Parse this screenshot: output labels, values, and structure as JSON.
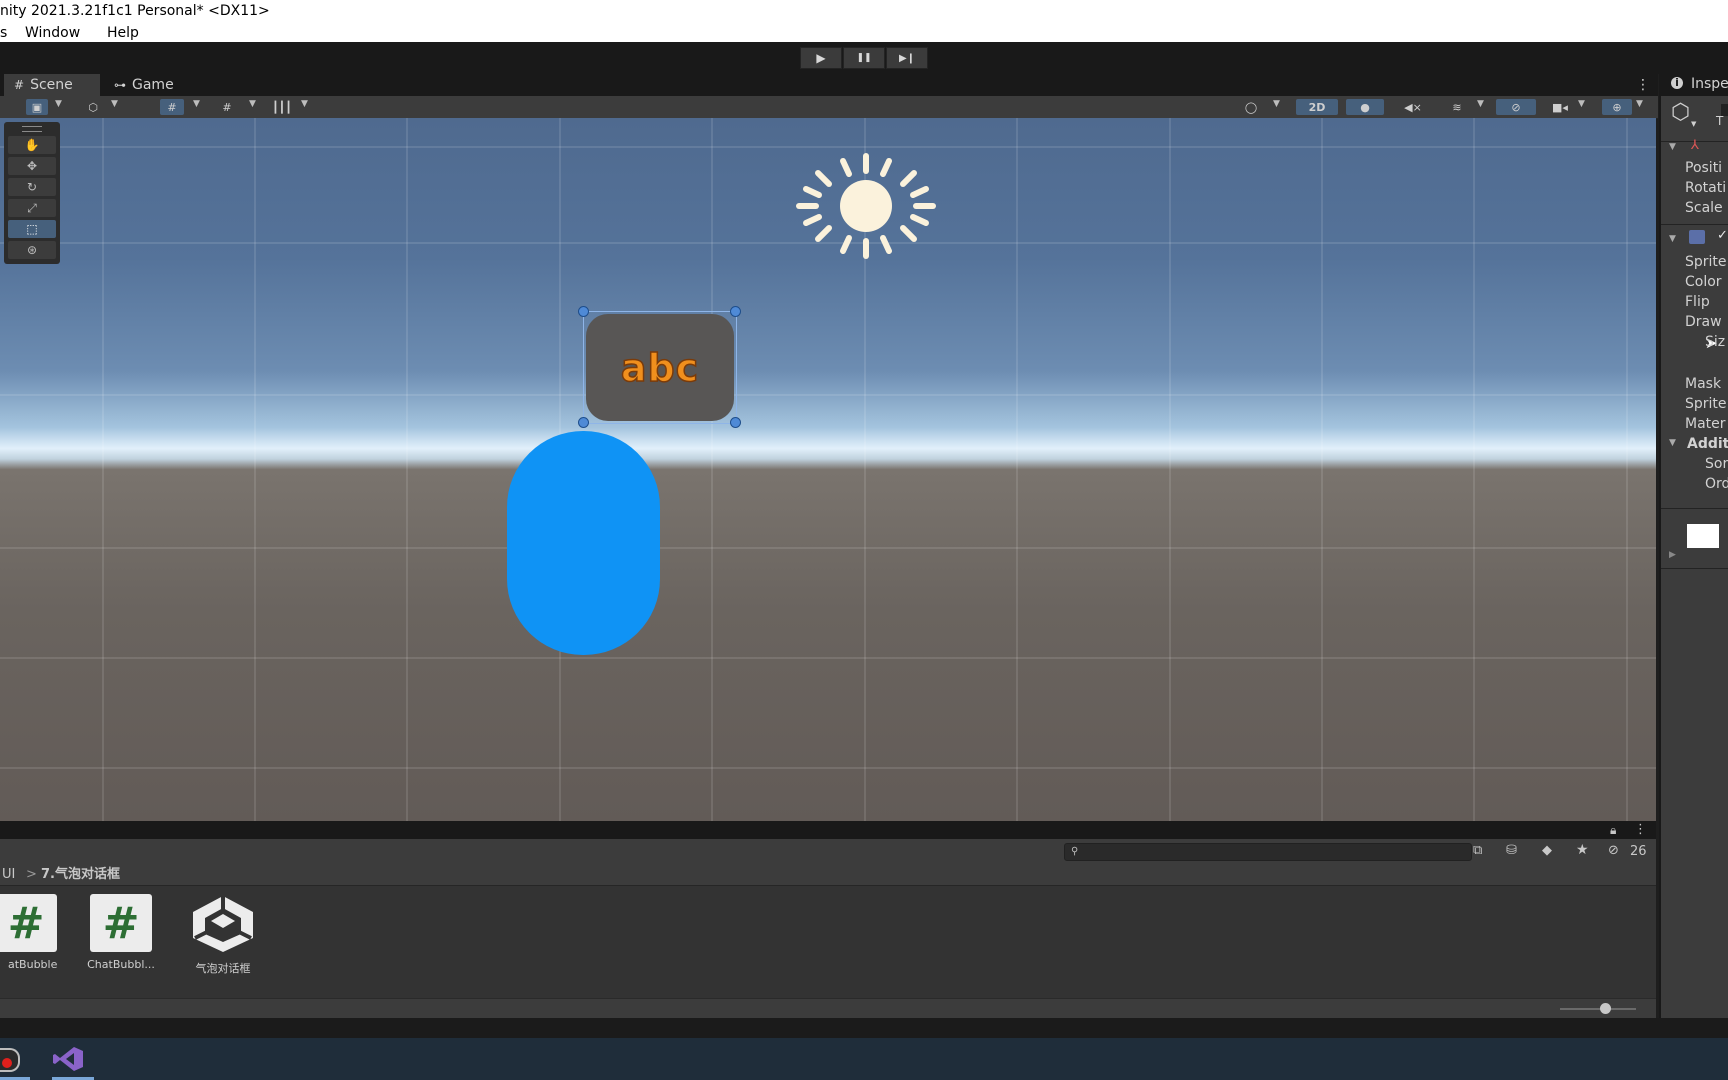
{
  "window": {
    "title": "nity 2021.3.21f1c1 Personal* <DX11>"
  },
  "menu": {
    "items": [
      "s",
      "Window",
      "Help"
    ]
  },
  "play_controls": {
    "play": "▶",
    "pause": "❚❚",
    "step": "▶❙"
  },
  "scene_view": {
    "tabs": [
      {
        "label": "Scene",
        "icon": "grid-hash-icon"
      },
      {
        "label": "Game",
        "icon": "gamepad-icon"
      }
    ],
    "toggle_2d": "2D",
    "tools": [
      "hand-tool",
      "move-tool",
      "rotate-tool",
      "scale-tool",
      "rect-tool",
      "transform-tool"
    ],
    "selected_object_text": "abc",
    "colors": {
      "capsule": "#0f93f5",
      "sun": "#fbf2dc",
      "text_fill": "#f08f1d",
      "sprite_bg": "#585655"
    }
  },
  "inspector": {
    "tab": "Inspe",
    "header_sub": "T",
    "transform_rows": [
      "Positi",
      "Rotati",
      "Scale"
    ],
    "renderer_rows": [
      "Sprite",
      "Color",
      "Flip",
      "Draw",
      "Siz",
      "Mask",
      "Sprite",
      "Mater"
    ],
    "additional": {
      "heading": "Additi",
      "rows": [
        "Sor",
        "Ord"
      ]
    }
  },
  "project": {
    "breadcrumb": {
      "root": "UI",
      "separator": ">",
      "folder": "7.气泡对话框"
    },
    "search": {
      "placeholder": ""
    },
    "hidden_count": "26",
    "assets": [
      {
        "label": "atBubble",
        "kind": "cs-script"
      },
      {
        "label": "ChatBubbl...",
        "kind": "cs-script"
      },
      {
        "label": "气泡对话框",
        "kind": "unity-scene"
      }
    ]
  }
}
